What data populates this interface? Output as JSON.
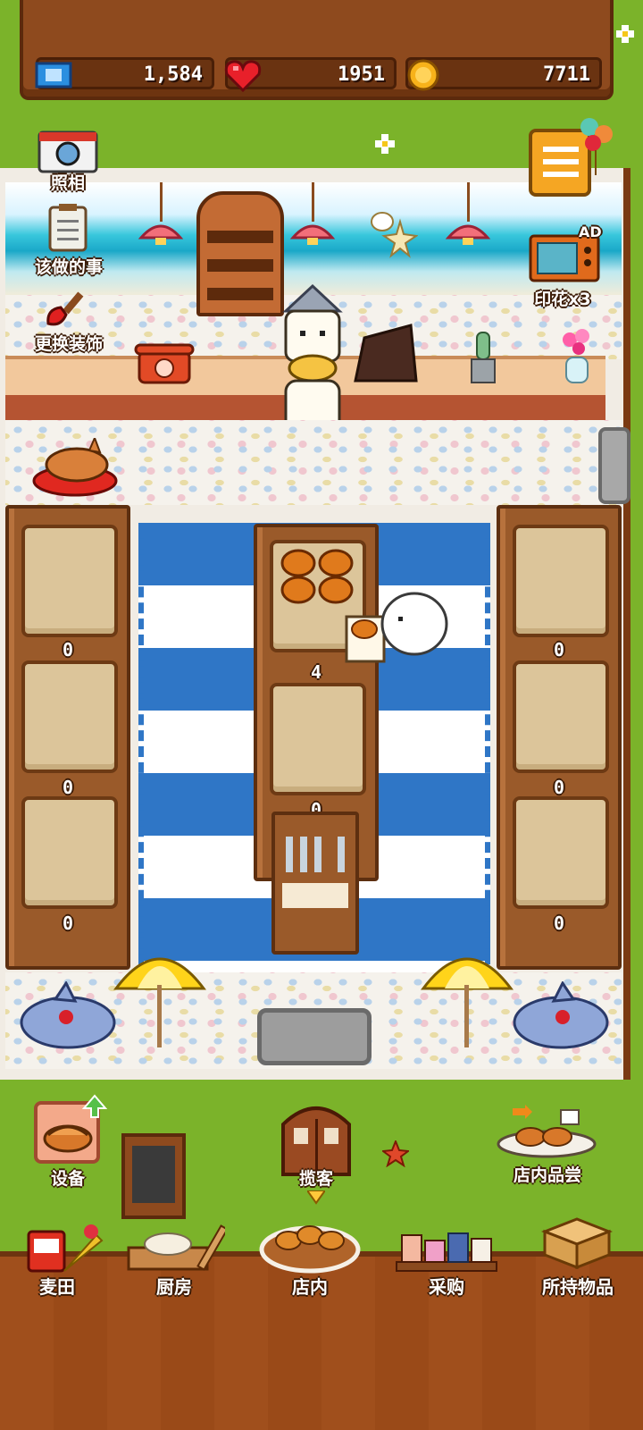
{
  "status_bar": {
    "tickets": "1,584",
    "hearts": "1951",
    "coins": "7711"
  },
  "side_menu": {
    "photo_label": "照相",
    "todo_label": "该做的事",
    "decor_label": "更换装饰",
    "stamp_label": "印花x3",
    "ad_badge": "AD"
  },
  "shelves": {
    "left_counts": [
      "0",
      "0",
      "0"
    ],
    "center_counts": [
      "4",
      "0"
    ],
    "right_counts": [
      "0",
      "0",
      "0"
    ]
  },
  "actions": {
    "equipment_label": "设备",
    "invite_label": "揽客",
    "taste_label": "店内品尝"
  },
  "nav": {
    "items": [
      {
        "label": "麦田",
        "icon": "wheat-icon"
      },
      {
        "label": "厨房",
        "icon": "kitchen-icon"
      },
      {
        "label": "店内",
        "icon": "bread-basket-icon"
      },
      {
        "label": "采购",
        "icon": "shop-icon"
      },
      {
        "label": "所持物品",
        "icon": "box-icon"
      }
    ],
    "active_index": 2
  },
  "colors": {
    "accent": "#f5a623",
    "wood": "#8e4a1e",
    "grass": "#7bb32a",
    "rug_blue": "#2f76c6"
  }
}
